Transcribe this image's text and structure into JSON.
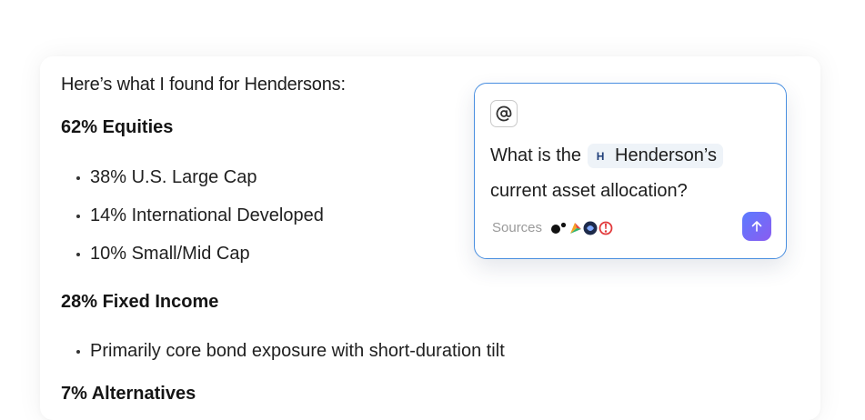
{
  "response": {
    "intro": "Here’s what I found for Hendersons:",
    "sections": [
      {
        "title": "62% Equities",
        "bullets": [
          "38% U.S. Large Cap",
          "14% International Developed",
          "10% Small/Mid Cap"
        ]
      },
      {
        "title": "28% Fixed Income",
        "bullets": [
          "Primarily core bond exposure with short-duration tilt"
        ]
      },
      {
        "title": "7% Alternatives"
      }
    ]
  },
  "prompt": {
    "mention_icon": "at-icon",
    "question_prefix": "What is the",
    "entity_chip": {
      "logo_letter": "H",
      "label": "Henderson’s"
    },
    "question_suffix": "current asset allocation?",
    "sources_label": "Sources",
    "source_icons": [
      "dot-logo",
      "colorful-logo",
      "dark-circle-logo",
      "red-target-logo"
    ],
    "send_icon": "arrow-up-icon",
    "accent_color": "#4a8fe0",
    "send_gradient": [
      "#5b7bff",
      "#8a5cf0"
    ]
  }
}
